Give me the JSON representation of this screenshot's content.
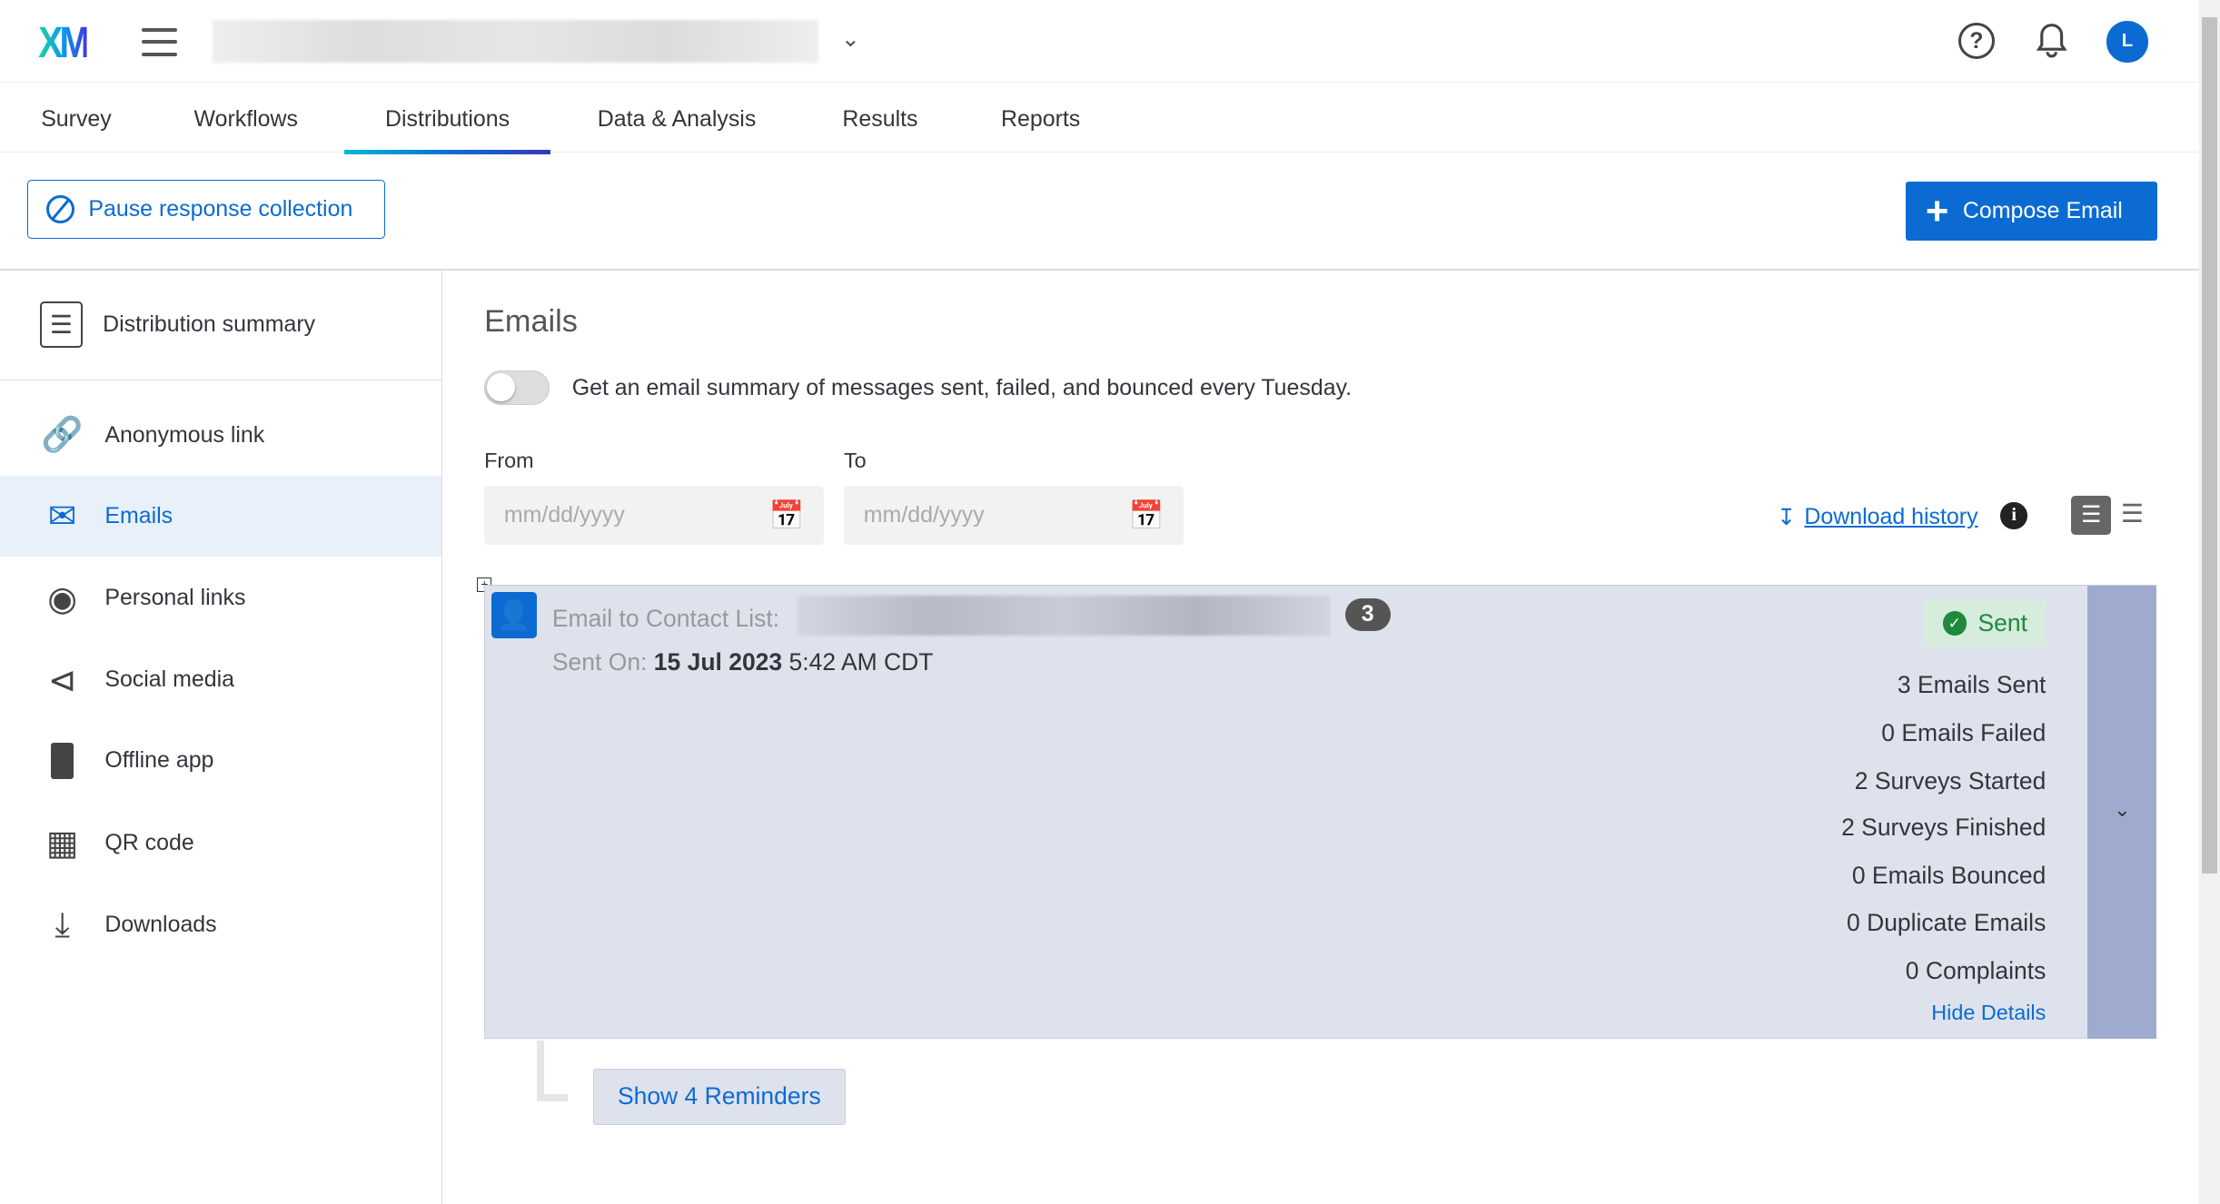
{
  "header": {
    "logo": "XM",
    "survey_name_blurred": "",
    "avatar_initial": "L"
  },
  "tabs": [
    {
      "label": "Survey"
    },
    {
      "label": "Workflows"
    },
    {
      "label": "Distributions",
      "active": true
    },
    {
      "label": "Data & Analysis"
    },
    {
      "label": "Results"
    },
    {
      "label": "Reports"
    }
  ],
  "toolbar": {
    "pause_label": "Pause response collection",
    "compose_label": "Compose Email"
  },
  "sidebar": {
    "items": [
      {
        "label": "Distribution summary",
        "icon": "list-icon"
      },
      {
        "label": "Anonymous link",
        "icon": "link-icon"
      },
      {
        "label": "Emails",
        "icon": "envelope-icon",
        "selected": true
      },
      {
        "label": "Personal links",
        "icon": "fingerprint-icon"
      },
      {
        "label": "Social media",
        "icon": "share-icon"
      },
      {
        "label": "Offline app",
        "icon": "tablet-icon"
      },
      {
        "label": "QR code",
        "icon": "qr-code-icon"
      },
      {
        "label": "Downloads",
        "icon": "download-icon"
      }
    ]
  },
  "emails": {
    "title": "Emails",
    "summary_toggle_label": "Get an email summary of messages sent, failed, and bounced every Tuesday.",
    "summary_toggle_on": false,
    "from_label": "From",
    "to_label": "To",
    "from_placeholder": "mm/dd/yyyy",
    "to_placeholder": "mm/dd/yyyy",
    "download_history": "Download history"
  },
  "distribution": {
    "title_prefix": "Email to Contact List:",
    "count": "3",
    "sent_on_label": "Sent On:",
    "sent_date": "15 Jul 2023",
    "sent_time": "5:42 AM CDT",
    "status": "Sent",
    "stats": [
      "3 Emails Sent",
      "0 Emails Failed",
      "2 Surveys Started",
      "2 Surveys Finished",
      "0 Emails Bounced",
      "0 Duplicate Emails",
      "0 Complaints"
    ],
    "hide_details": "Hide Details",
    "show_reminders": "Show 4 Reminders"
  },
  "colors": {
    "accent": "#0b6bd3",
    "card_bg": "#dee2ed",
    "sent_green": "#1e8a3c"
  }
}
